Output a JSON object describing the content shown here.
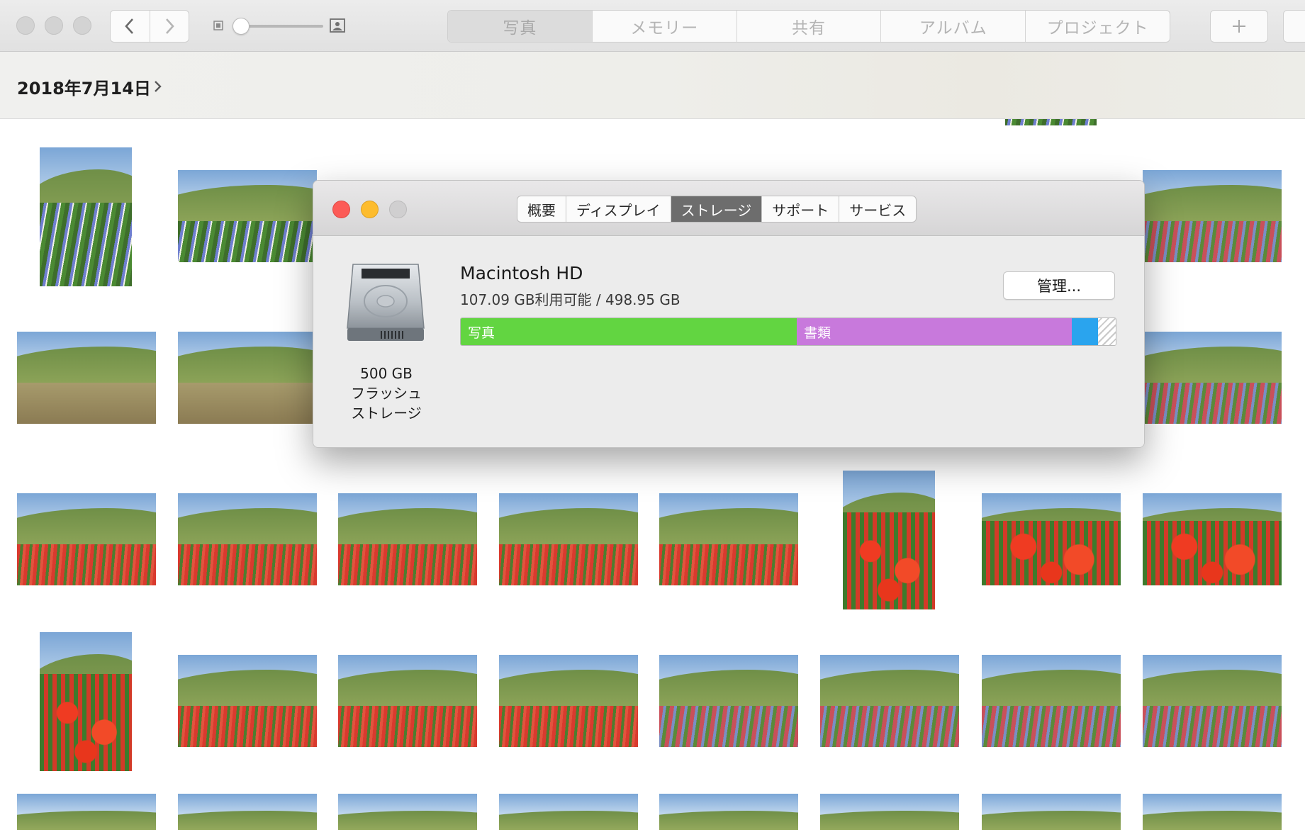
{
  "toolbar": {
    "tabs": [
      {
        "label": "写真",
        "active": true
      },
      {
        "label": "メモリー",
        "active": false
      },
      {
        "label": "共有",
        "active": false
      },
      {
        "label": "アルバム",
        "active": false
      },
      {
        "label": "プロジェクト",
        "active": false
      }
    ],
    "icons": [
      "back-chevron-icon",
      "forward-chevron-icon",
      "zoom-out-icon",
      "zoom-in-icon",
      "plus-icon"
    ]
  },
  "date_header": {
    "title": "2018年7月14日"
  },
  "dialog": {
    "tabs": [
      {
        "label": "概要",
        "active": false
      },
      {
        "label": "ディスプレイ",
        "active": false
      },
      {
        "label": "ストレージ",
        "active": true
      },
      {
        "label": "サポート",
        "active": false
      },
      {
        "label": "サービス",
        "active": false
      }
    ],
    "disk": {
      "name": "Macintosh HD",
      "capacity": "107.09 GB利用可能 / 498.95 GB",
      "caption_line1": "500 GB",
      "caption_line2": "フラッシュ",
      "caption_line3": "ストレージ"
    },
    "manage_label": "管理...",
    "usage": [
      {
        "label": "写真",
        "color": "#62d541",
        "fraction": 0.513
      },
      {
        "label": "書類",
        "color": "#c879dc",
        "fraction": 0.42
      },
      {
        "label": "",
        "color": "#2aa4ee",
        "fraction": 0.04
      },
      {
        "label": "",
        "color": "free",
        "fraction": 0.027
      }
    ]
  }
}
